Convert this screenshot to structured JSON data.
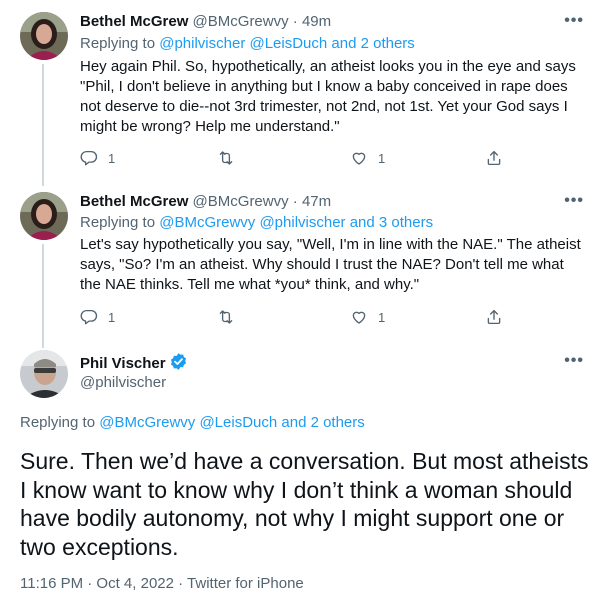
{
  "tweets": [
    {
      "name": "Bethel McGrew",
      "handle": "@BMcGrewvy",
      "sep": "·",
      "time": "49m",
      "more": "•••",
      "replying_prefix": "Replying to",
      "replying_links": "@philvischer @LeisDuch and 2 others",
      "body": "Hey again Phil. So, hypothetically, an atheist looks you in the eye and says \"Phil, I don't believe in anything but I know a baby conceived in rape does not deserve to die--not 3rd trimester, not 2nd, not 1st. Yet your God says I might be wrong? Help me understand.\"",
      "replies": "1",
      "likes": "1"
    },
    {
      "name": "Bethel McGrew",
      "handle": "@BMcGrewvy",
      "sep": "·",
      "time": "47m",
      "more": "•••",
      "replying_prefix": "Replying to",
      "replying_links": "@BMcGrewvy @philvischer and 3 others",
      "body": "Let's say hypothetically you say, \"Well, I'm in line with the NAE.\" The atheist says, \"So? I'm an atheist. Why should I trust the NAE? Don't tell me what the NAE thinks. Tell me what *you* think, and why.\"",
      "replies": "1",
      "likes": "1"
    }
  ],
  "main_tweet": {
    "name": "Phil Vischer",
    "handle": "@philvischer",
    "more": "•••",
    "replying_prefix": "Replying to",
    "replying_links": "@BMcGrewvy @LeisDuch and 2 others",
    "body": "Sure. Then we’d have a conversation. But most atheists I know want to know why I don’t think a woman should have bodily autonomy, not why I might support one or two exceptions.",
    "meta": "11:16 PM · Oct 4, 2022 · Twitter for iPhone"
  },
  "colors": {
    "accent": "#1d9bf0",
    "secondary_text": "#536471",
    "thread_line": "#cfd9de"
  },
  "icons": [
    "reply-icon",
    "retweet-icon",
    "like-icon",
    "share-icon",
    "verified-badge-icon",
    "more-icon"
  ]
}
